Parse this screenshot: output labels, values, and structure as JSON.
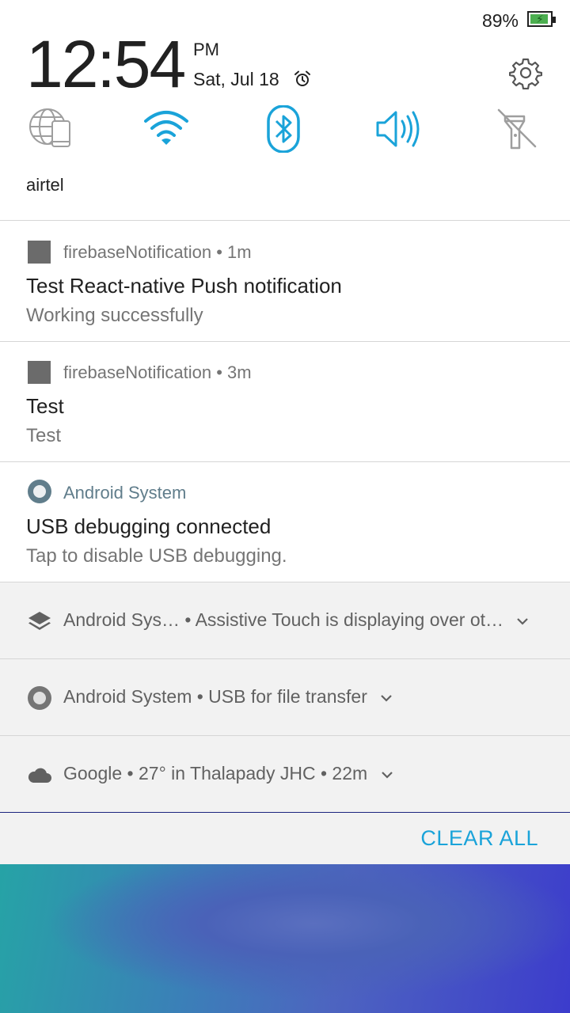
{
  "status_bar": {
    "battery_percent": "89%"
  },
  "header": {
    "time": "12:54",
    "ampm": "PM",
    "date": "Sat, Jul 18",
    "carrier": "airtel"
  },
  "quick_settings": [
    {
      "name": "mobile-data",
      "icon": "globe-phone-icon",
      "active": false
    },
    {
      "name": "wifi",
      "icon": "wifi-icon",
      "active": true
    },
    {
      "name": "bluetooth",
      "icon": "bluetooth-icon",
      "active": true
    },
    {
      "name": "sound",
      "icon": "speaker-icon",
      "active": true
    },
    {
      "name": "flashlight",
      "icon": "flashlight-off-icon",
      "active": false
    }
  ],
  "notifications": [
    {
      "app": "firebaseNotification",
      "time": "1m",
      "app_line": "firebaseNotification • 1m",
      "title": "Test React-native Push notification",
      "text": "Working successfully"
    },
    {
      "app": "firebaseNotification",
      "time": "3m",
      "app_line": "firebaseNotification • 3m",
      "title": "Test",
      "text": "Test"
    },
    {
      "app": "Android System",
      "title": "USB debugging connected",
      "text": "Tap to disable USB debugging."
    }
  ],
  "collapsed": [
    {
      "line": "Android Sys… • Assistive Touch is displaying over ot…",
      "icon": "layers-icon"
    },
    {
      "line": "Android System • USB for file transfer",
      "icon": "android-system-icon"
    },
    {
      "line": "Google • 27° in Thalapady JHC • 22m",
      "icon": "cloud-icon"
    }
  ],
  "footer": {
    "clear_all": "CLEAR ALL"
  },
  "colors": {
    "accent": "#1aa3d9",
    "battery": "#4caf50"
  }
}
